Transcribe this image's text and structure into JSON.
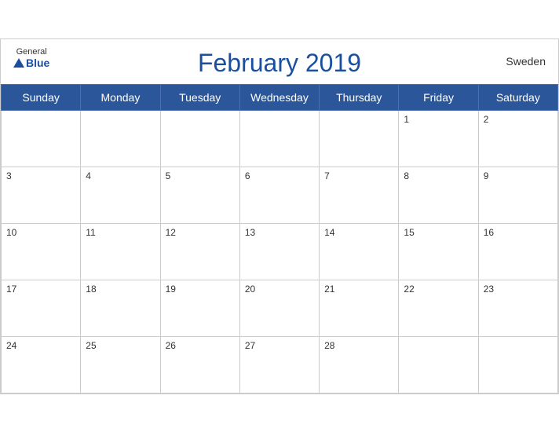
{
  "header": {
    "logo_general": "General",
    "logo_blue": "Blue",
    "title": "February 2019",
    "country": "Sweden"
  },
  "days": [
    "Sunday",
    "Monday",
    "Tuesday",
    "Wednesday",
    "Thursday",
    "Friday",
    "Saturday"
  ],
  "weeks": [
    [
      {
        "date": "",
        "empty": true
      },
      {
        "date": "",
        "empty": true
      },
      {
        "date": "",
        "empty": true
      },
      {
        "date": "",
        "empty": true
      },
      {
        "date": "",
        "empty": true
      },
      {
        "date": "1",
        "empty": false
      },
      {
        "date": "2",
        "empty": false
      }
    ],
    [
      {
        "date": "3",
        "empty": false
      },
      {
        "date": "4",
        "empty": false
      },
      {
        "date": "5",
        "empty": false
      },
      {
        "date": "6",
        "empty": false
      },
      {
        "date": "7",
        "empty": false
      },
      {
        "date": "8",
        "empty": false
      },
      {
        "date": "9",
        "empty": false
      }
    ],
    [
      {
        "date": "10",
        "empty": false
      },
      {
        "date": "11",
        "empty": false
      },
      {
        "date": "12",
        "empty": false
      },
      {
        "date": "13",
        "empty": false
      },
      {
        "date": "14",
        "empty": false
      },
      {
        "date": "15",
        "empty": false
      },
      {
        "date": "16",
        "empty": false
      }
    ],
    [
      {
        "date": "17",
        "empty": false
      },
      {
        "date": "18",
        "empty": false
      },
      {
        "date": "19",
        "empty": false
      },
      {
        "date": "20",
        "empty": false
      },
      {
        "date": "21",
        "empty": false
      },
      {
        "date": "22",
        "empty": false
      },
      {
        "date": "23",
        "empty": false
      }
    ],
    [
      {
        "date": "24",
        "empty": false
      },
      {
        "date": "25",
        "empty": false
      },
      {
        "date": "26",
        "empty": false
      },
      {
        "date": "27",
        "empty": false
      },
      {
        "date": "28",
        "empty": false
      },
      {
        "date": "",
        "empty": true
      },
      {
        "date": "",
        "empty": true
      }
    ]
  ]
}
